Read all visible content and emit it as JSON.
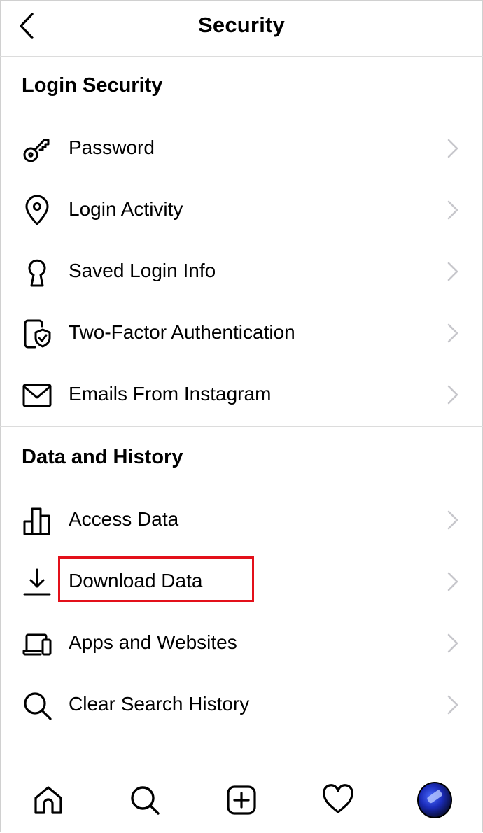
{
  "header": {
    "title": "Security"
  },
  "sections": [
    {
      "title": "Login Security",
      "items": [
        {
          "label": "Password",
          "icon": "key-icon"
        },
        {
          "label": "Login Activity",
          "icon": "location-pin-icon"
        },
        {
          "label": "Saved Login Info",
          "icon": "keyhole-icon"
        },
        {
          "label": "Two-Factor Authentication",
          "icon": "phone-shield-icon"
        },
        {
          "label": "Emails From Instagram",
          "icon": "envelope-icon"
        }
      ]
    },
    {
      "title": "Data and History",
      "items": [
        {
          "label": "Access Data",
          "icon": "bar-chart-icon"
        },
        {
          "label": "Download Data",
          "icon": "download-icon"
        },
        {
          "label": "Apps and Websites",
          "icon": "laptop-phone-icon"
        },
        {
          "label": "Clear Search History",
          "icon": "search-icon"
        }
      ]
    }
  ],
  "tabbar": {
    "tabs": [
      "home-icon",
      "search-icon",
      "new-post-icon",
      "heart-icon",
      "profile-avatar"
    ]
  },
  "colors": {
    "highlight": "#e3101a",
    "divider": "#dcdcdc",
    "chevron": "#c7c7cc"
  }
}
